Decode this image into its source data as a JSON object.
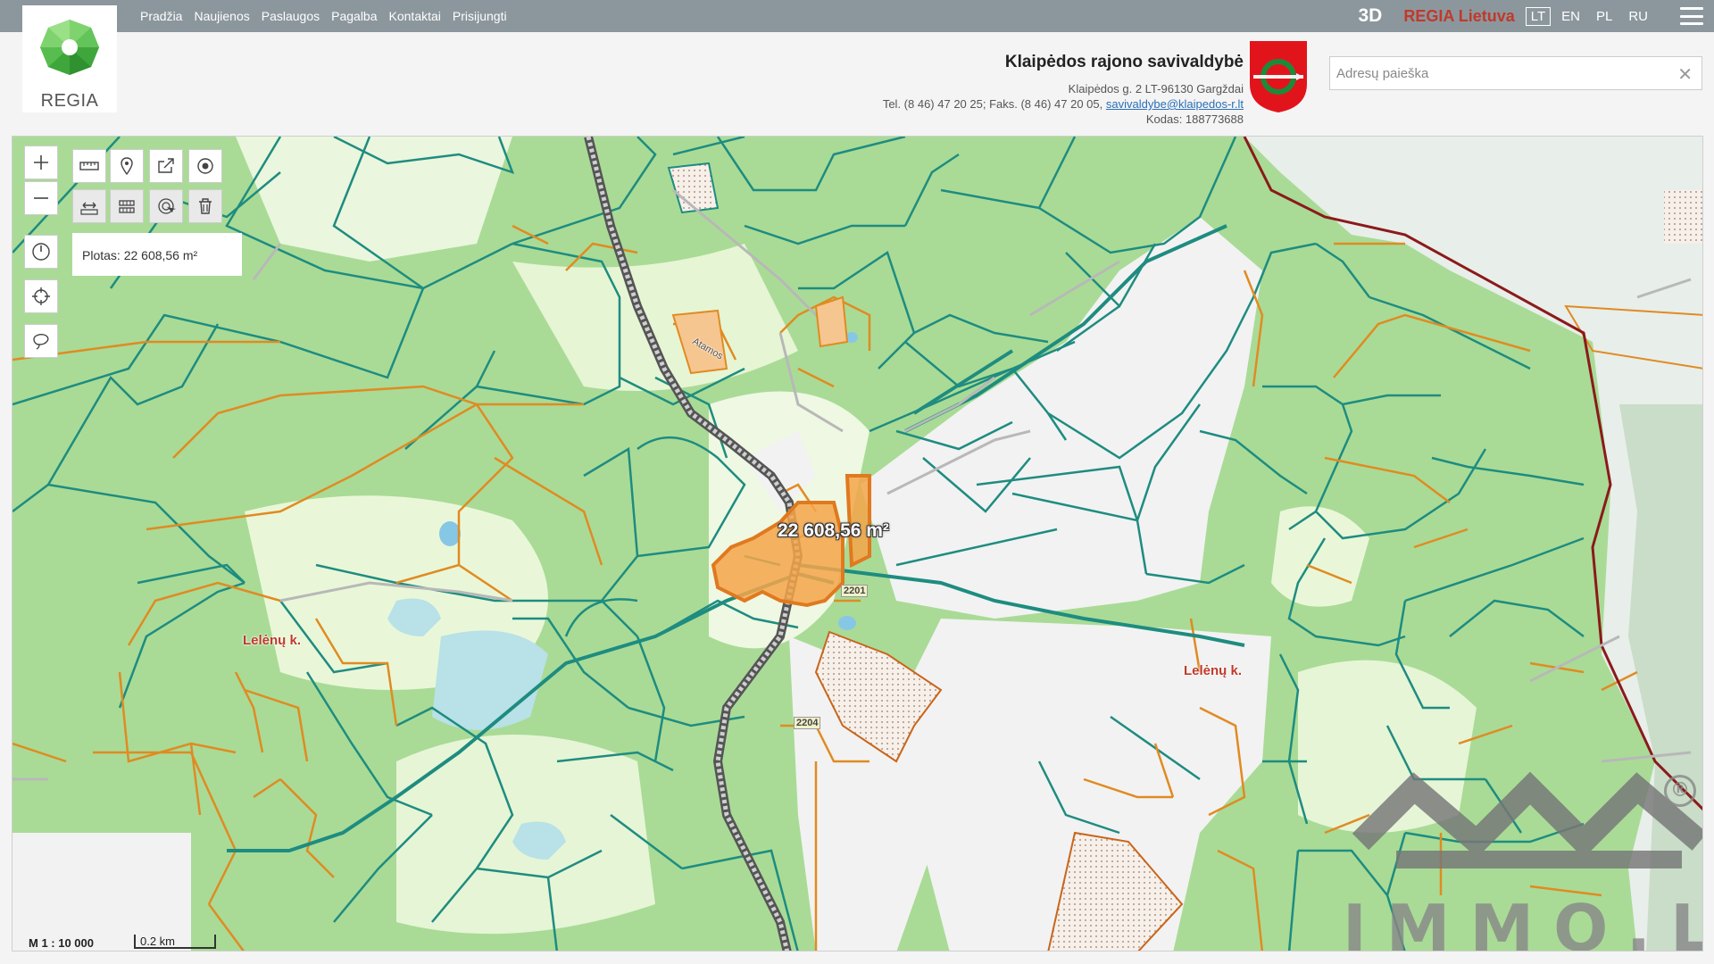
{
  "nav": {
    "items": [
      "Pradžia",
      "Naujienos",
      "Paslaugos",
      "Pagalba",
      "Kontaktai",
      "Prisijungti"
    ],
    "btn_3d": "3D",
    "regia_lietuva": "REGIA Lietuva",
    "languages": [
      "LT",
      "EN",
      "PL",
      "RU"
    ],
    "active_language": "LT"
  },
  "logo": {
    "text": "REGIA"
  },
  "municipality": {
    "title": "Klaipėdos rajono savivaldybė",
    "address": "Klaipėdos g. 2 LT-96130 Gargždai",
    "phones": "Tel. (8 46) 47 20 25; Faks. (8 46) 47 20 05,",
    "email": "savivaldybe@klaipedos-r.lt",
    "code": "Kodas: 188773688"
  },
  "search": {
    "placeholder": "Adresų paieška",
    "value": ""
  },
  "map": {
    "measured_area": "Plotas: 22 608,56 m²",
    "area_label": "22 608,56 m²",
    "scale_text": "M 1 : 10 000",
    "scale_bar_text": "0.2 km",
    "places": [
      "Lelėnų k.",
      "Lelėnų k."
    ],
    "road_numbers": [
      "2201",
      "2204"
    ],
    "street_labels": [
      "Atamos"
    ]
  },
  "tools": {
    "zoom_in": "zoom-in",
    "zoom_out": "zoom-out",
    "icons": [
      "ruler-icon",
      "marker-icon",
      "share-icon",
      "locate-target-icon",
      "measure-distance-icon",
      "measure-area-icon",
      "pointer-scan-icon",
      "trash-icon",
      "clock-icon",
      "crosshair-icon",
      "lasso-icon"
    ]
  },
  "watermark": {
    "text": "IMMO.LT",
    "registered": "®"
  },
  "colors": {
    "topbar": "#8c979d",
    "accent_red": "#c0392b",
    "parcel_teal": "#1e8c80",
    "parcel_orange": "#e08b22",
    "selected": "#f4a64a"
  }
}
